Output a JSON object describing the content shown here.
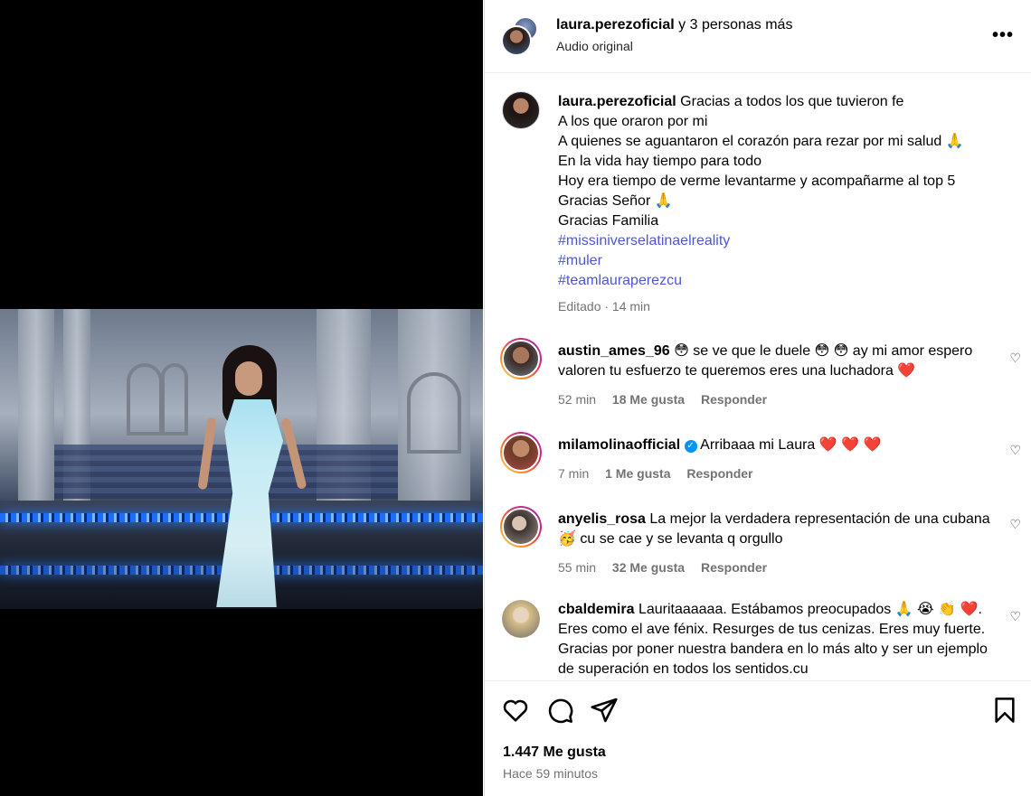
{
  "post": {
    "author": "laura.perezoficial",
    "coauthors_suffix": "y 3 personas más",
    "audio": "Audio original",
    "more_label": "•••"
  },
  "caption": {
    "user": "laura.perezoficial",
    "lines": [
      "Gracias a todos los que tuvieron fe",
      "A los que oraron por mi",
      "A quienes se aguantaron el corazón para rezar por mi salud 🙏",
      "En la vida hay tiempo para todo",
      "Hoy era tiempo de verme levantarme y acompañarme al top 5",
      "Gracias Señor 🙏",
      "Gracias Familia"
    ],
    "hashtags": [
      "#missiniverselatinaelreality",
      "#muler",
      "#teamlauraperezcu"
    ],
    "meta": "Editado · 14 min"
  },
  "comments": [
    {
      "user": "austin_ames_96",
      "text": "😳 se ve que le duele 😳 😳 ay mi amor espero valoren tu esfuerzo te queremos eres una luchadora ❤️",
      "time": "52 min",
      "likes": "18 Me gusta",
      "reply": "Responder"
    },
    {
      "user": "milamolinaofficial",
      "verified": "✓",
      "text": "Arribaaa mi Laura ❤️ ❤️ ❤️",
      "time": "7 min",
      "likes": "1 Me gusta",
      "reply": "Responder"
    },
    {
      "user": "anyelis_rosa",
      "text": "La mejor la verdadera representación de una cubana 🥳 cu se cae y se levanta q orgullo",
      "time": "55 min",
      "likes": "32 Me gusta",
      "reply": "Responder"
    },
    {
      "user": "cbaldemira",
      "text": "Lauritaaaaaa. Estábamos preocupados 🙏 😭 👏 ❤️. Eres como el ave fénix. Resurges de tus cenizas. Eres muy fuerte. Gracias por poner nuestra bandera en lo más alto y ser un ejemplo de superación en todos los sentidos.cu"
    }
  ],
  "footer": {
    "likes_count": "1.447 Me gusta",
    "time_ago": "Hace 59 minutos"
  }
}
